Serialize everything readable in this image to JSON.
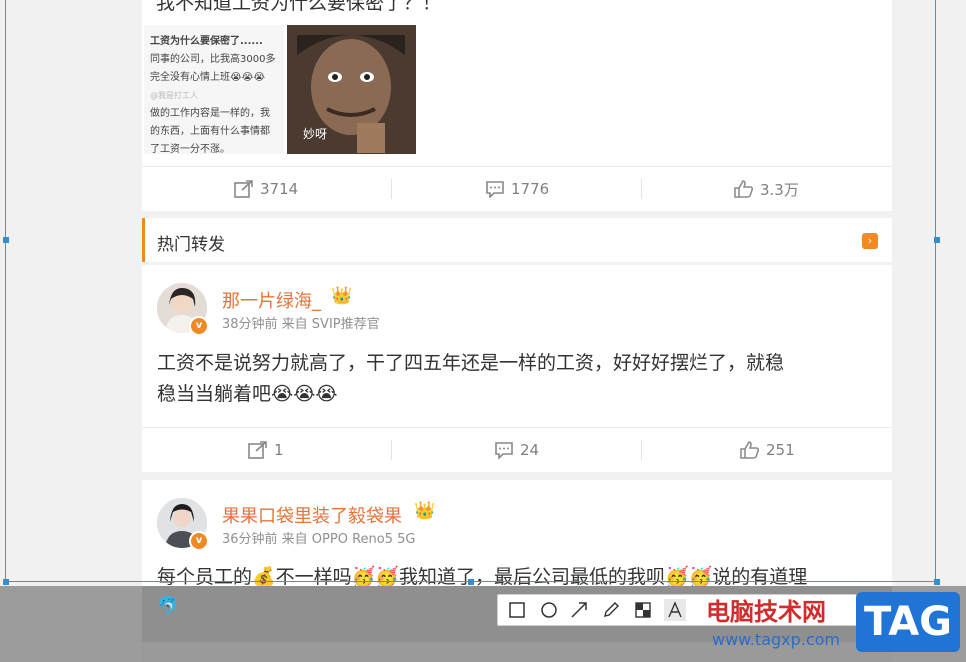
{
  "post_top": {
    "partial_text": "我不知道工资为什么要保密了？！",
    "image1_lines": [
      "工资为什么要保密了......",
      "同事的公司，比我高3000多",
      "完全没有心情上班😭😭😭",
      "@我是打工人",
      "做的工作内容是一样的，我",
      "的东西，上面有什么事情都",
      "了工资一分不涨。"
    ],
    "image2_caption": "妙呀",
    "actions": {
      "repost": "3714",
      "comment": "1776",
      "like": "3.3万"
    }
  },
  "section": {
    "title": "热门转发"
  },
  "posts": [
    {
      "name": "那一片绿海_",
      "meta": "38分钟前 来自 SVIP推荐官",
      "content_line1": "工资不是说努力就高了，干了四五年还是一样的工资，好好好摆烂了，就稳",
      "content_line2": "稳当当躺着吧😭😭😭",
      "actions": {
        "repost": "1",
        "comment": "24",
        "like": "251"
      }
    },
    {
      "name": "果果口袋里装了毅袋果",
      "meta": "36分钟前 来自 OPPO Reno5 5G",
      "content_line1": "每个员工的💰不一样吗🥳🥳我知道了，最后公司最低的我呗🥳🥳说的有道理"
    }
  ],
  "watermark": {
    "text": "电脑技术网",
    "url": "www.tagxp.com",
    "logo": "TAG"
  }
}
